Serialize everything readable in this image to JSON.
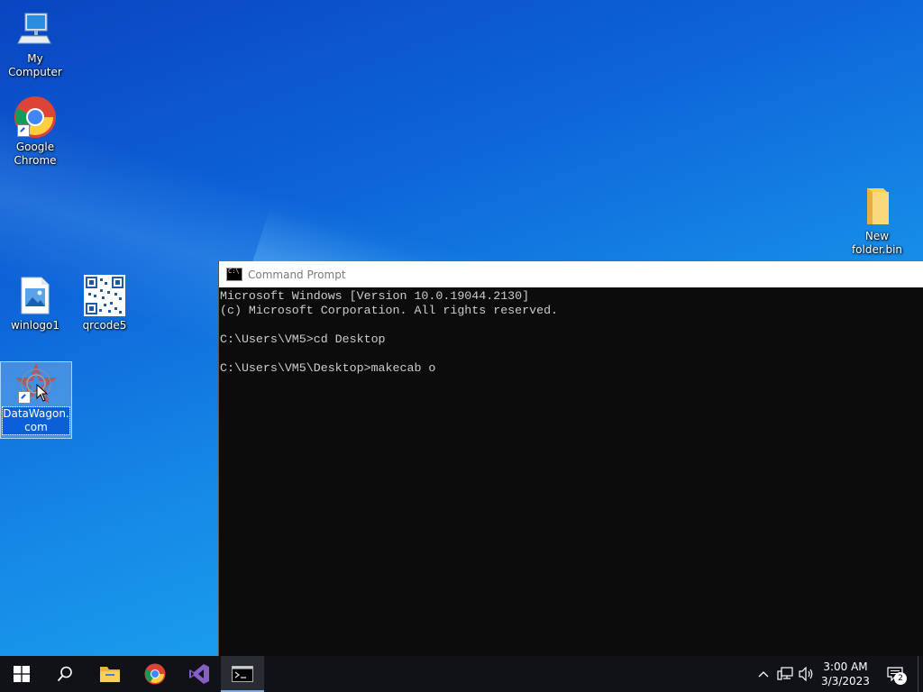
{
  "desktop": {
    "icons": [
      {
        "label": "My Computer",
        "icon": "computer-icon"
      },
      {
        "label": "Google Chrome",
        "icon": "chrome-icon"
      },
      {
        "label": "New folder.bin",
        "icon": "folder-icon"
      },
      {
        "label": "winlogo1",
        "icon": "image-file-icon"
      },
      {
        "label": "qrcode5",
        "icon": "qrcode-icon"
      },
      {
        "label": "DataWagon.com",
        "icon": "datawagon-icon"
      }
    ]
  },
  "cmd": {
    "title": "Command Prompt",
    "lines": [
      "Microsoft Windows [Version 10.0.19044.2130]",
      "(c) Microsoft Corporation. All rights reserved.",
      "",
      "C:\\Users\\VM5>cd Desktop",
      "",
      "C:\\Users\\VM5\\Desktop>makecab o"
    ]
  },
  "taskbar": {
    "items": [
      "start-button",
      "search-button",
      "file-explorer",
      "chrome",
      "visual-studio",
      "command-prompt"
    ],
    "clock": {
      "time": "3:00 AM",
      "date": "3/3/2023"
    },
    "notifications_count": "2"
  },
  "colors": {
    "taskbar": "#101217",
    "desktop_accent": "#0d63d8",
    "console_bg": "#0c0c0c",
    "console_text": "#cccccc"
  }
}
